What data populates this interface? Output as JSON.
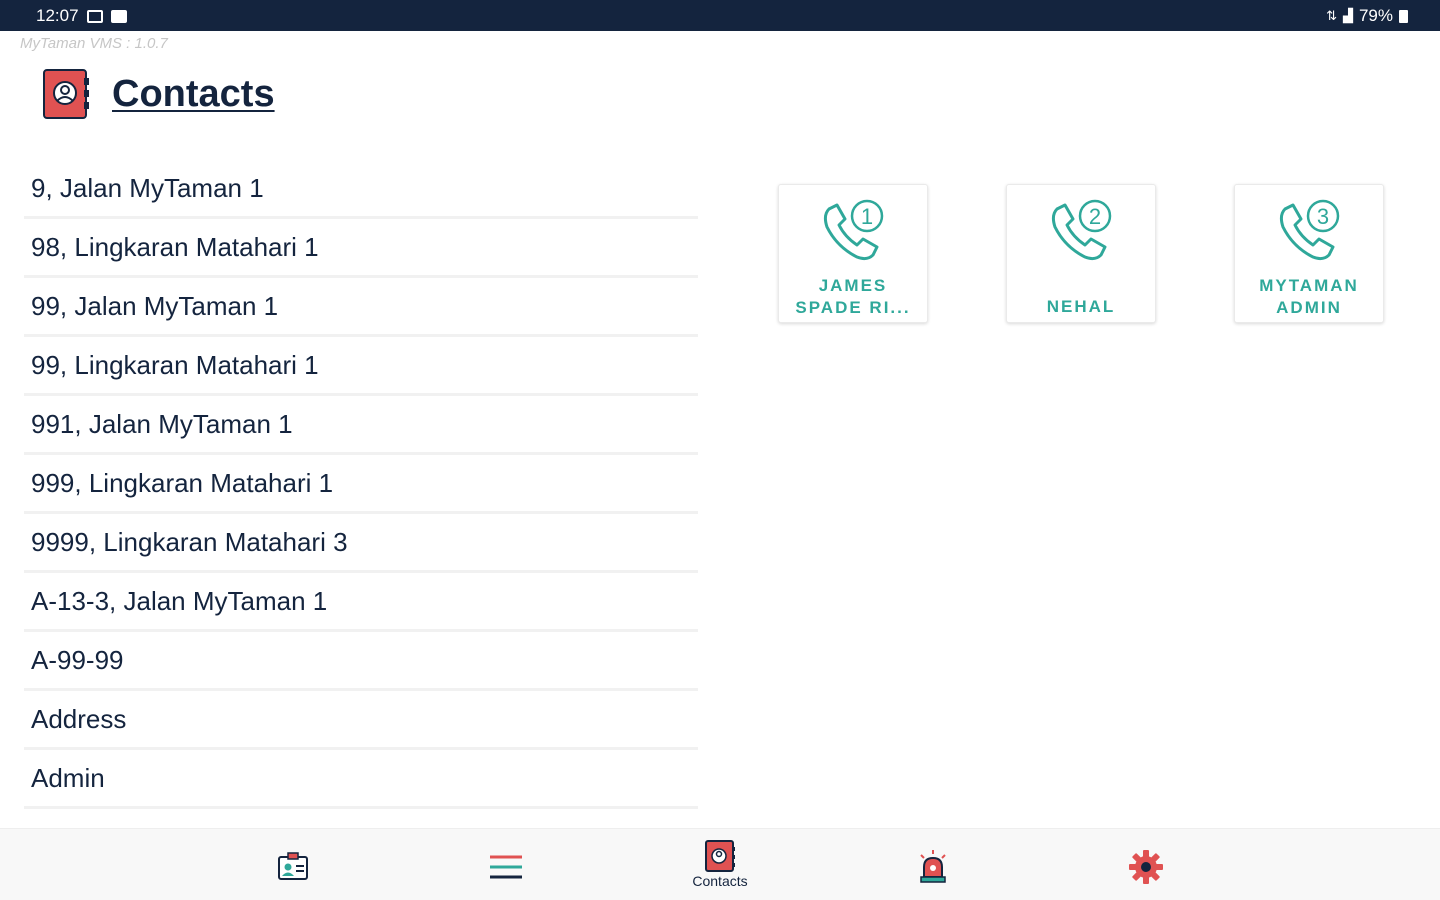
{
  "status_bar": {
    "time": "12:07",
    "battery": "79%"
  },
  "app": {
    "version": "MyTaman VMS : 1.0.7"
  },
  "header": {
    "title": "Contacts"
  },
  "contacts": [
    "9, Jalan MyTaman 1",
    "98, Lingkaran Matahari 1",
    "99, Jalan MyTaman 1",
    "99, Lingkaran Matahari 1",
    "991, Jalan MyTaman 1",
    "999, Lingkaran Matahari 1",
    "9999, Lingkaran Matahari 3",
    "A-13-3, Jalan MyTaman 1",
    "A-99-99",
    "Address",
    "Admin"
  ],
  "hotlines": [
    {
      "number": "1",
      "line1": "JAMES",
      "line2": "SPADE RI..."
    },
    {
      "number": "2",
      "line1": "NEHAL",
      "line2": ""
    },
    {
      "number": "3",
      "line1": "MYTAMAN",
      "line2": "ADMIN"
    }
  ],
  "bottom_nav": {
    "visitors_icon": "id-card-icon",
    "menu_icon": "hamburger-menu-icon",
    "contacts_label": "Contacts",
    "alarm_icon": "siren-icon",
    "settings_icon": "gear-icon"
  },
  "colors": {
    "navy": "#14243e",
    "teal": "#2fa89a",
    "red": "#e05252",
    "divider": "#f1f1f1"
  }
}
